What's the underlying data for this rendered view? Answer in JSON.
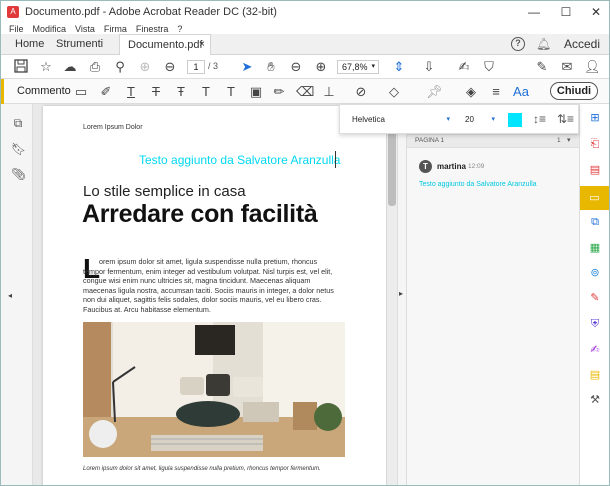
{
  "window": {
    "title": "Documento.pdf - Adobe Acrobat Reader DC (32-bit)"
  },
  "menu": [
    "File",
    "Modifica",
    "Vista",
    "Firma",
    "Finestra",
    "?"
  ],
  "tabs": {
    "home": "Home",
    "tools": "Strumenti",
    "doc": "Documento.pdf",
    "close": "×",
    "signin": "Accedi"
  },
  "toolbar": {
    "page_current": "1",
    "page_sep": "/",
    "page_total": "3",
    "zoom": "67,8%"
  },
  "commentbar": {
    "label": "Commento",
    "close": "Chiudi",
    "text_tool": "Aa"
  },
  "fontpanel": {
    "font": "Helvetica",
    "size": "20",
    "color": "#00e5ff"
  },
  "document": {
    "header": "Lorem Ipsum Dolor",
    "added_text": "Testo aggiunto da Salvatore Aranzulla",
    "subtitle": "Lo stile semplice in casa",
    "headline": "Arredare con facilità",
    "dropcap": "L",
    "body": "orem ipsum dolor sit amet, ligula suspendisse nulla pretium, rhoncus tempor fermentum, enim integer ad vestibulum volutpat. Nisl turpis est, vel elit, congue wisi enim nunc ultricies sit, magna tincidunt. Maecenas aliquam maecenas ligula nostra, accumsan taciti. Sociis mauris in integer, a dolor netus non dui aliquet, sagittis felis sodales, dolor sociis mauris, vel eu libero cras. Faucibus at. Arcu habitasse elementum.",
    "caption": "Lorem ipsum dolor sit amet, ligula suspendisse nulla pretium, rhoncus tempor fermentum."
  },
  "comments": {
    "page_label": "PAGINA 1",
    "count": "1",
    "avatar": "T",
    "author": "martina",
    "time": "12:09",
    "text": "Testo aggiunto da Salvatore Aranzulla"
  },
  "colors": {
    "accent": "#e8b800",
    "added_text": "#00d8f0",
    "brand": "#e03a3a"
  }
}
